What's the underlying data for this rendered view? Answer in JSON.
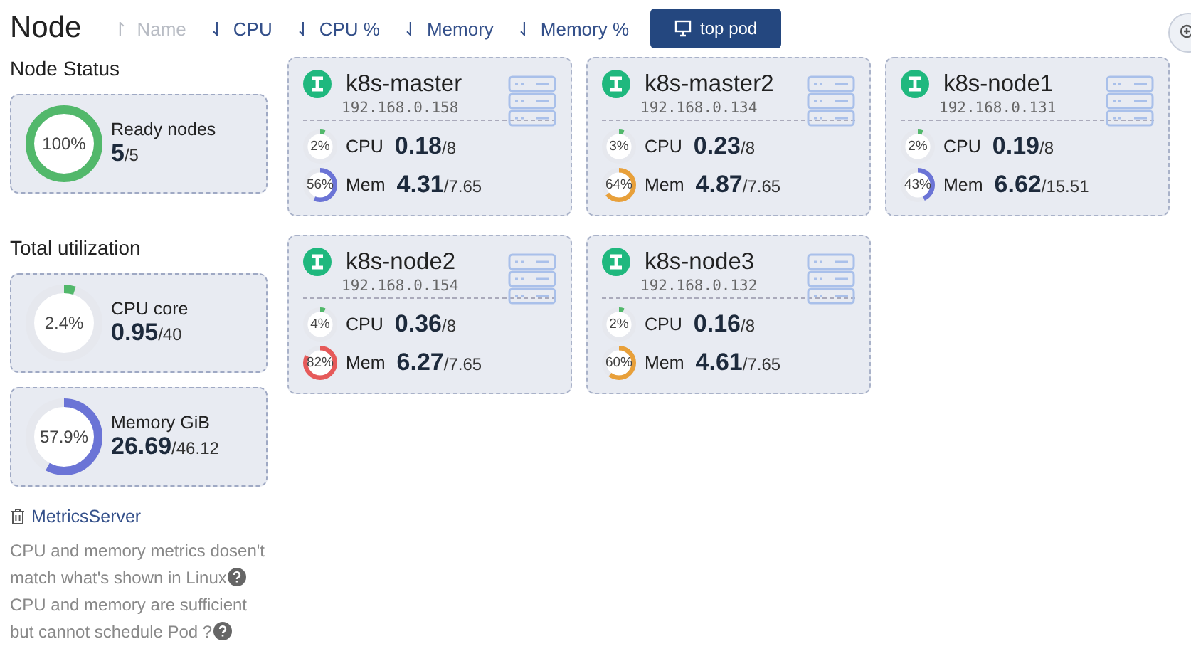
{
  "title": "Node",
  "sort_options": [
    {
      "arrow": "↾",
      "label": "Name",
      "active": false
    },
    {
      "arrow": "⇃",
      "label": "CPU",
      "active": true
    },
    {
      "arrow": "⇃",
      "label": "CPU %",
      "active": true
    },
    {
      "arrow": "⇃",
      "label": "Memory",
      "active": true
    },
    {
      "arrow": "⇃",
      "label": "Memory %",
      "active": true
    }
  ],
  "top_pod_button": "top pod",
  "node_status": {
    "heading": "Node Status",
    "gauge": {
      "percent": "100%",
      "color": "#52b86b",
      "label": "Ready nodes",
      "value": "5",
      "total": "/5"
    }
  },
  "total_utilization": {
    "heading": "Total utilization",
    "gauges": [
      {
        "percent": "2.4%",
        "label": "CPU core",
        "value": "0.95",
        "total": "/40"
      },
      {
        "percent": "57.9%",
        "color": "#6b74d6",
        "label": "Memory GiB",
        "value": "26.69",
        "total": "/46.12"
      }
    ]
  },
  "metrics_server_link": "MetricsServer",
  "help_lines": [
    "CPU and memory metrics dosen't match what's shown in Linux",
    "CPU and memory are sufficient but cannot schedule Pod ?"
  ],
  "nodes": [
    {
      "name": "k8s-master",
      "ip": "192.168.0.158",
      "cpu": {
        "percent": "2%",
        "label": "CPU",
        "value": "0.18",
        "total": "/8"
      },
      "mem": {
        "percent": "56%",
        "color": "#6b74d6",
        "label": "Mem",
        "value": "4.31",
        "total": "/7.65"
      }
    },
    {
      "name": "k8s-master2",
      "ip": "192.168.0.134",
      "cpu": {
        "percent": "3%",
        "label": "CPU",
        "value": "0.23",
        "total": "/8"
      },
      "mem": {
        "percent": "64%",
        "color": "#e8a03a",
        "label": "Mem",
        "value": "4.87",
        "total": "/7.65"
      }
    },
    {
      "name": "k8s-node1",
      "ip": "192.168.0.131",
      "cpu": {
        "percent": "2%",
        "label": "CPU",
        "value": "0.19",
        "total": "/8"
      },
      "mem": {
        "percent": "43%",
        "color": "#6b74d6",
        "label": "Mem",
        "value": "6.62",
        "total": "/15.51"
      }
    },
    {
      "name": "k8s-node2",
      "ip": "192.168.0.154",
      "cpu": {
        "percent": "4%",
        "label": "CPU",
        "value": "0.36",
        "total": "/8"
      },
      "mem": {
        "percent": "82%",
        "color": "#e65a5a",
        "label": "Mem",
        "value": "6.27",
        "total": "/7.65"
      }
    },
    {
      "name": "k8s-node3",
      "ip": "192.168.0.132",
      "cpu": {
        "percent": "2%",
        "label": "CPU",
        "value": "0.16",
        "total": "/8"
      },
      "mem": {
        "percent": "60%",
        "color": "#e8a03a",
        "label": "Mem",
        "value": "4.61",
        "total": "/7.65"
      }
    }
  ]
}
